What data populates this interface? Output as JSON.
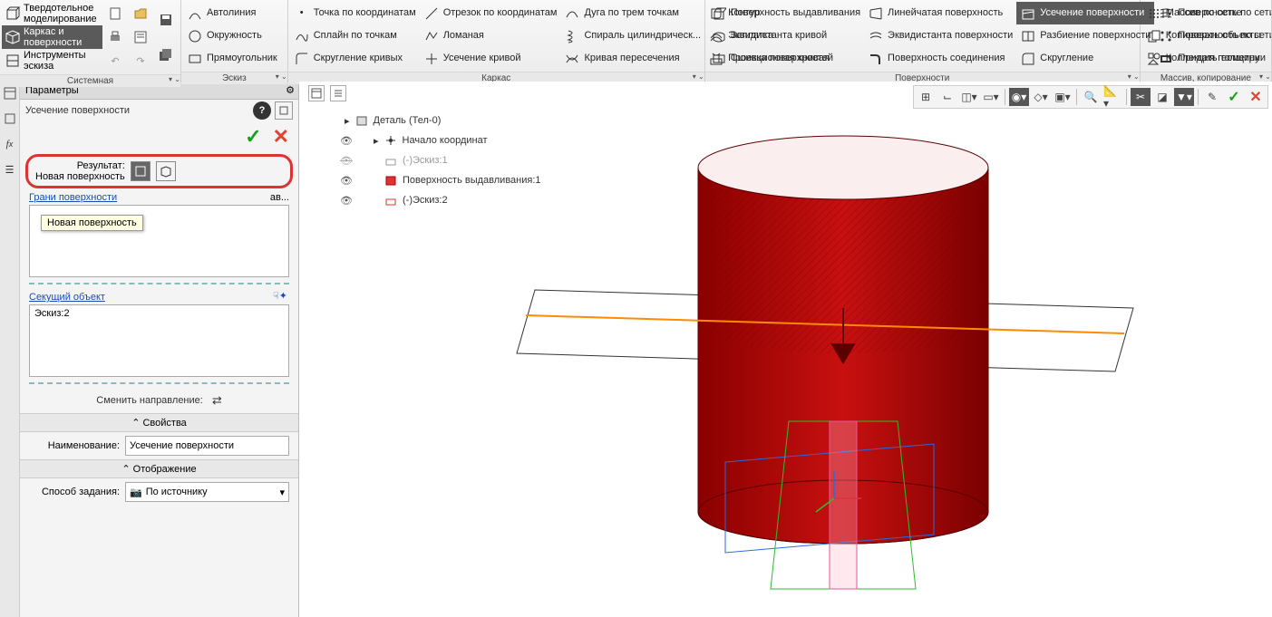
{
  "ribbon": {
    "side_tabs": [
      "Твердотельное моделирование",
      "Каркас и поверхности",
      "Инструменты эскиза"
    ],
    "group_system": "Системная",
    "group_sketch": {
      "title": "Эскиз",
      "items": [
        "Автолиния",
        "Окружность",
        "Прямоугольник"
      ]
    },
    "group_frame": {
      "title": "Каркас",
      "col1": [
        "Точка по координатам",
        "Сплайн по точкам",
        "Скругление кривых"
      ],
      "col2": [
        "Отрезок по координатам",
        "Ломаная",
        "Усечение кривой"
      ],
      "col3": [
        "Дуга по трем точкам",
        "Спираль цилиндрическ...",
        "Кривая пересечения"
      ],
      "col4": [
        "Контур",
        "Эквидистанта кривой",
        "Проекционная кривая"
      ]
    },
    "group_surf": {
      "title": "Поверхности",
      "col1": [
        "Поверхность выдавливания",
        "Заплатка",
        "Сшивка поверхностей"
      ],
      "col2": [
        "Линейчатая поверхность",
        "Эквидистанта поверхности",
        "Поверхность соединения"
      ],
      "col3": [
        "Усечение поверхности",
        "Разбиение поверхности",
        "Скругление"
      ],
      "col4": [
        "Поверхность по сети кривых",
        "Поверхность по сети точек",
        "Придать толщину"
      ]
    },
    "group_copy": {
      "title": "Массив, копирование",
      "items": [
        "Массив по сетке",
        "Копировать объекты",
        "Коллекция геометрии"
      ]
    }
  },
  "panel": {
    "title": "Параметры",
    "cmd_title": "Усечение поверхности",
    "result_label": "Результат:",
    "result_value": "Новая поверхность",
    "tooltip": "Новая поверхность",
    "faces_link": "Грани поверхности",
    "faces_trail": "ав...",
    "cut_link": "Секущий объект",
    "cut_value": "Эскиз:2",
    "dir_label": "Сменить направление:",
    "section_props": "Свойства",
    "name_label": "Наименование:",
    "name_value": "Усечение поверхности",
    "section_disp": "Отображение",
    "mode_label": "Способ задания:",
    "mode_value": "По источнику"
  },
  "tree": {
    "root": "Деталь (Тел-0)",
    "items": [
      {
        "label": "Начало координат",
        "vis": true,
        "color": "#333"
      },
      {
        "label": "(-)Эскиз:1",
        "vis": false,
        "color": "#888"
      },
      {
        "label": "Поверхность выдавливания:1",
        "vis": true,
        "color": "#c00"
      },
      {
        "label": "(-)Эскиз:2",
        "vis": true,
        "color": "#c00"
      }
    ]
  },
  "chart_data": null
}
